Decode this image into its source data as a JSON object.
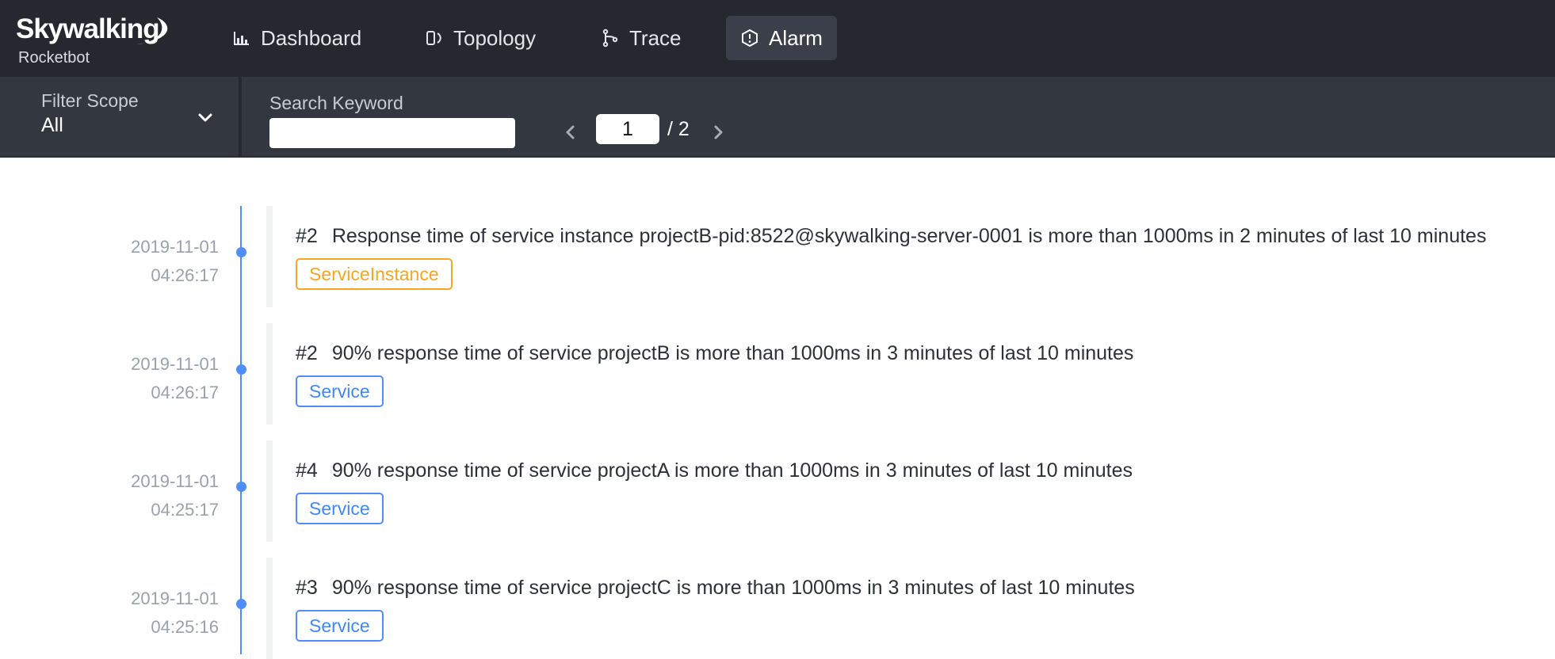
{
  "brand": {
    "name": "Skywalking",
    "subtitle": "Rocketbot"
  },
  "nav": {
    "items": [
      {
        "label": "Dashboard",
        "icon": "bar-chart-icon"
      },
      {
        "label": "Topology",
        "icon": "topology-icon"
      },
      {
        "label": "Trace",
        "icon": "trace-icon"
      },
      {
        "label": "Alarm",
        "icon": "alarm-icon",
        "active": true
      }
    ]
  },
  "filter": {
    "scope_label": "Filter Scope",
    "scope_value": "All",
    "keyword_label": "Search Keyword",
    "keyword_value": ""
  },
  "pager": {
    "current": "1",
    "total_text": "/ 2"
  },
  "alarms": [
    {
      "date": "2019-11-01",
      "time": "04:26:17",
      "id": "#2",
      "message": "Response time of service instance projectB-pid:8522@skywalking-server-0001 is more than 1000ms in 2 minutes of last 10 minutes",
      "scope": "ServiceInstance"
    },
    {
      "date": "2019-11-01",
      "time": "04:26:17",
      "id": "#2",
      "message": "90% response time of service projectB is more than 1000ms in 3 minutes of last 10 minutes",
      "scope": "Service"
    },
    {
      "date": "2019-11-01",
      "time": "04:25:17",
      "id": "#4",
      "message": "90% response time of service projectA is more than 1000ms in 3 minutes of last 10 minutes",
      "scope": "Service"
    },
    {
      "date": "2019-11-01",
      "time": "04:25:16",
      "id": "#3",
      "message": "90% response time of service projectC is more than 1000ms in 3 minutes of last 10 minutes",
      "scope": "Service"
    }
  ],
  "colors": {
    "accent": "#4f8ef7",
    "instance_tag": "#f5a623",
    "topbar": "#25292f",
    "filterbar": "#333840"
  }
}
